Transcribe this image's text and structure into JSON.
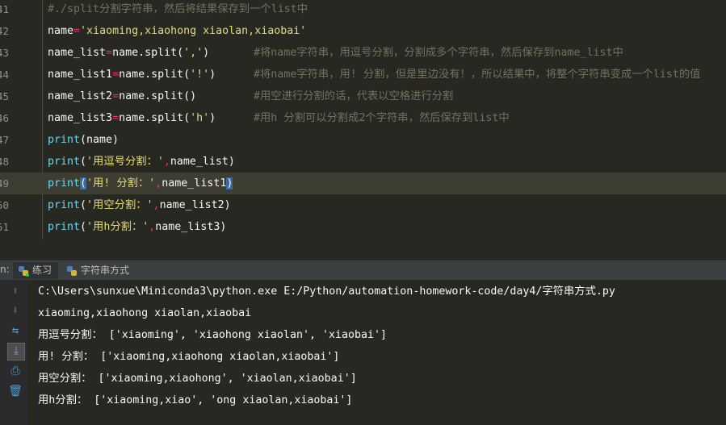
{
  "editor": {
    "lines": [
      {
        "num": "41",
        "segments": [
          {
            "t": "#./split分割字符串，然后将结果保存到一个list中",
            "c": "cm"
          }
        ],
        "comment": ""
      },
      {
        "num": "42",
        "segments": [
          {
            "t": "name",
            "c": "pl"
          },
          {
            "t": "=",
            "c": "op"
          },
          {
            "t": "'xiaoming,xiaohong xiaolan,xiaobai'",
            "c": "str"
          }
        ],
        "comment": ""
      },
      {
        "num": "43",
        "segments": [
          {
            "t": "name_list",
            "c": "pl"
          },
          {
            "t": "=",
            "c": "op"
          },
          {
            "t": "name.split(",
            "c": "pl"
          },
          {
            "t": "','",
            "c": "str"
          },
          {
            "t": ")",
            "c": "pl"
          }
        ],
        "comment": "#将name字符串，用逗号分割，分割成多个字符串，然后保存到name_list中"
      },
      {
        "num": "44",
        "segments": [
          {
            "t": "name_list1",
            "c": "pl"
          },
          {
            "t": "=",
            "c": "op"
          },
          {
            "t": "name.split(",
            "c": "pl"
          },
          {
            "t": "'!'",
            "c": "str"
          },
          {
            "t": ")",
            "c": "pl"
          }
        ],
        "comment": "#将name字符串，用! 分割，但是里边没有！，所以结果中，将整个字符串变成一个list的值"
      },
      {
        "num": "45",
        "segments": [
          {
            "t": "name_list2",
            "c": "pl"
          },
          {
            "t": "=",
            "c": "op"
          },
          {
            "t": "name.split()",
            "c": "pl"
          }
        ],
        "comment": "#用空进行分割的话，代表以空格进行分割"
      },
      {
        "num": "46",
        "segments": [
          {
            "t": "name_list3",
            "c": "pl"
          },
          {
            "t": "=",
            "c": "op"
          },
          {
            "t": "name.split(",
            "c": "pl"
          },
          {
            "t": "'h'",
            "c": "str"
          },
          {
            "t": ")",
            "c": "pl"
          }
        ],
        "comment": "#用h 分割可以分割成2个字符串，然后保存到list中"
      },
      {
        "num": "47",
        "segments": [
          {
            "t": "print",
            "c": "kw"
          },
          {
            "t": "(name)",
            "c": "pl"
          }
        ],
        "comment": ""
      },
      {
        "num": "48",
        "segments": [
          {
            "t": "print",
            "c": "kw"
          },
          {
            "t": "(",
            "c": "pl"
          },
          {
            "t": "'用逗号分割：'",
            "c": "str"
          },
          {
            "t": ",",
            "c": "op"
          },
          {
            "t": "name_list)",
            "c": "pl"
          }
        ],
        "comment": ""
      },
      {
        "num": "49",
        "segments": [
          {
            "t": "print",
            "c": "kw"
          },
          {
            "t": "(",
            "c": "br"
          },
          {
            "t": "'用! 分割：'",
            "c": "str"
          },
          {
            "t": ",",
            "c": "op"
          },
          {
            "t": "name_list1",
            "c": "pl"
          },
          {
            "t": ")",
            "c": "br"
          }
        ],
        "comment": "",
        "highlight": true
      },
      {
        "num": "50",
        "segments": [
          {
            "t": "print",
            "c": "kw"
          },
          {
            "t": "(",
            "c": "pl"
          },
          {
            "t": "'用空分割：'",
            "c": "str"
          },
          {
            "t": ",",
            "c": "op"
          },
          {
            "t": "name_list2)",
            "c": "pl"
          }
        ],
        "comment": ""
      },
      {
        "num": "51",
        "segments": [
          {
            "t": "print",
            "c": "kw"
          },
          {
            "t": "(",
            "c": "pl"
          },
          {
            "t": "'用h分割：'",
            "c": "str"
          },
          {
            "t": ",",
            "c": "op"
          },
          {
            "t": "name_list3)",
            "c": "pl"
          }
        ],
        "comment": ""
      }
    ]
  },
  "run_panel": {
    "label": "n:",
    "tabs": [
      {
        "label": "练习",
        "active": true
      },
      {
        "label": "字符串方式",
        "active": false
      }
    ],
    "output": [
      "C:\\Users\\sunxue\\Miniconda3\\python.exe E:/Python/automation-homework-code/day4/字符串方式.py",
      "xiaoming,xiaohong xiaolan,xiaobai",
      "用逗号分割： ['xiaoming', 'xiaohong xiaolan', 'xiaobai']",
      "用! 分割： ['xiaoming,xiaohong xiaolan,xiaobai']",
      "用空分割： ['xiaoming,xiaohong', 'xiaolan,xiaobai']",
      "用h分割： ['xiaoming,xiao', 'ong xiaolan,xiaobai']"
    ]
  }
}
